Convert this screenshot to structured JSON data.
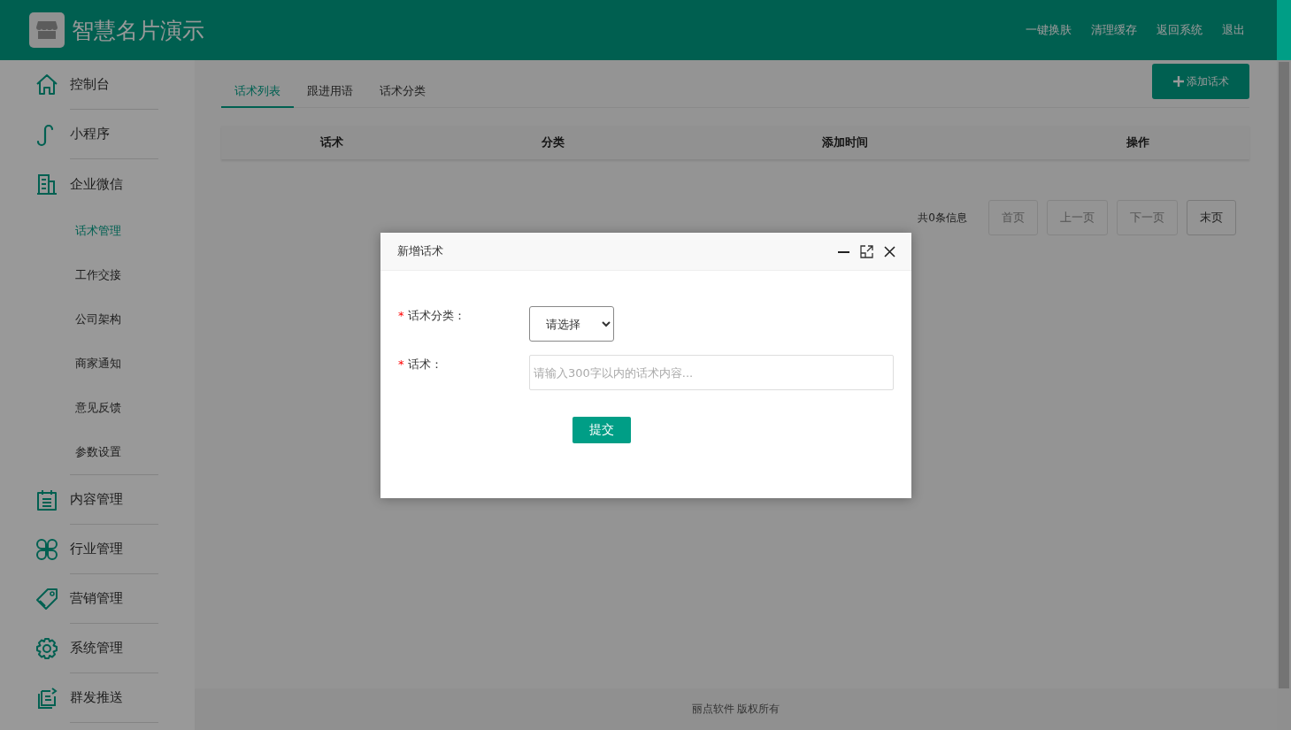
{
  "header": {
    "title": "智慧名片演示",
    "links": [
      "一键换肤",
      "清理缓存",
      "返回系统",
      "退出"
    ]
  },
  "sidebar": {
    "items": [
      {
        "label": "控制台"
      },
      {
        "label": "小程序"
      },
      {
        "label": "企业微信",
        "children": [
          {
            "label": "话术管理",
            "selected": true
          },
          {
            "label": "工作交接",
            "selected": false
          },
          {
            "label": "公司架构",
            "selected": false
          },
          {
            "label": "商家通知",
            "selected": false
          },
          {
            "label": "意见反馈",
            "selected": false
          },
          {
            "label": "参数设置",
            "selected": false
          }
        ]
      },
      {
        "label": "内容管理"
      },
      {
        "label": "行业管理"
      },
      {
        "label": "营销管理"
      },
      {
        "label": "系统管理"
      },
      {
        "label": "群发推送"
      }
    ]
  },
  "tabs": [
    {
      "label": "话术列表",
      "selected": true
    },
    {
      "label": "跟进用语",
      "selected": false
    },
    {
      "label": "话术分类",
      "selected": false
    }
  ],
  "add_button": "添加话术",
  "table": {
    "columns": [
      "话术",
      "分类",
      "添加时间",
      "操作"
    ]
  },
  "pagination": {
    "summary": "共0条信息",
    "buttons": [
      {
        "label": "首页",
        "disabled": true
      },
      {
        "label": "上一页",
        "disabled": true
      },
      {
        "label": "下一页",
        "disabled": true
      },
      {
        "label": "末页",
        "disabled": false
      }
    ]
  },
  "footer": "丽点软件 版权所有",
  "dialog": {
    "title": "新增话术",
    "fields": [
      {
        "kind": "select",
        "required_mark": "*",
        "label": "话术分类：",
        "value": "请选择"
      },
      {
        "kind": "text",
        "required_mark": "*",
        "label": "话术：",
        "placeholder": "请输入300字以内的话术内容..."
      }
    ],
    "submit": "提交"
  }
}
